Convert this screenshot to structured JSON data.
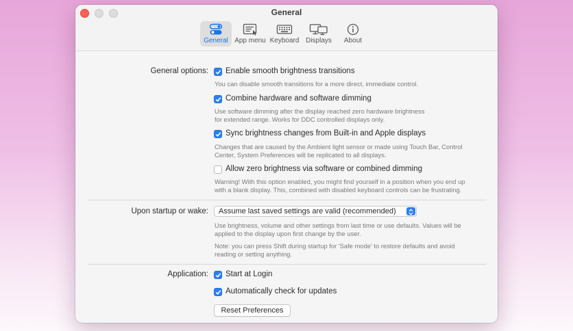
{
  "window": {
    "title": "General"
  },
  "tabs": [
    {
      "label": "General",
      "icon": "toggles-icon",
      "active": true
    },
    {
      "label": "App menu",
      "icon": "app-menu-icon",
      "active": false
    },
    {
      "label": "Keyboard",
      "icon": "keyboard-icon",
      "active": false
    },
    {
      "label": "Displays",
      "icon": "displays-icon",
      "active": false
    },
    {
      "label": "About",
      "icon": "info-icon",
      "active": false
    }
  ],
  "general": {
    "label": "General options:",
    "options": [
      {
        "label": "Enable smooth brightness transitions",
        "checked": true,
        "desc": [
          "You can disable smooth transitions for a more direct, immediate control."
        ]
      },
      {
        "label": "Combine hardware and software dimming",
        "checked": true,
        "desc": [
          "Use software dimming after the display reached zero hardware brightness",
          "for extended range. Works for DDC controlled displays only."
        ]
      },
      {
        "label": "Sync brightness changes from Built-in and Apple displays",
        "checked": true,
        "desc": [
          "Changes that are caused by the Ambient light sensor or made using Touch Bar, Control",
          "Center, System Preferences will be replicated to all displays."
        ]
      },
      {
        "label": "Allow zero brightness via software or combined dimming",
        "checked": false,
        "desc": [
          "Warning! With this option enabled, you might find yourself in a position when you end up",
          "with a blank display. This, combined with disabled keyboard controls can be frustrating."
        ]
      }
    ]
  },
  "startup": {
    "label": "Upon startup or wake:",
    "selected": "Assume last saved settings are valid (recommended)",
    "desc1": [
      "Use brightness, volume and other settings from last time or use defaults. Values will be",
      "applied to the display upon first change by the user."
    ],
    "desc2": [
      "Note: you can press Shift during startup for 'Safe mode' to restore defaults and avoid",
      "reading or setting anything."
    ]
  },
  "application": {
    "label": "Application:",
    "start_at_login": {
      "label": "Start at Login",
      "checked": true
    },
    "auto_update": {
      "label": "Automatically check for updates",
      "checked": true
    },
    "reset_button": "Reset Preferences"
  },
  "colors": {
    "accent": "#2c7ff5",
    "close": "#ff5f57",
    "background_top": "#e7a6d9",
    "background_bottom": "#fdf8fc"
  }
}
